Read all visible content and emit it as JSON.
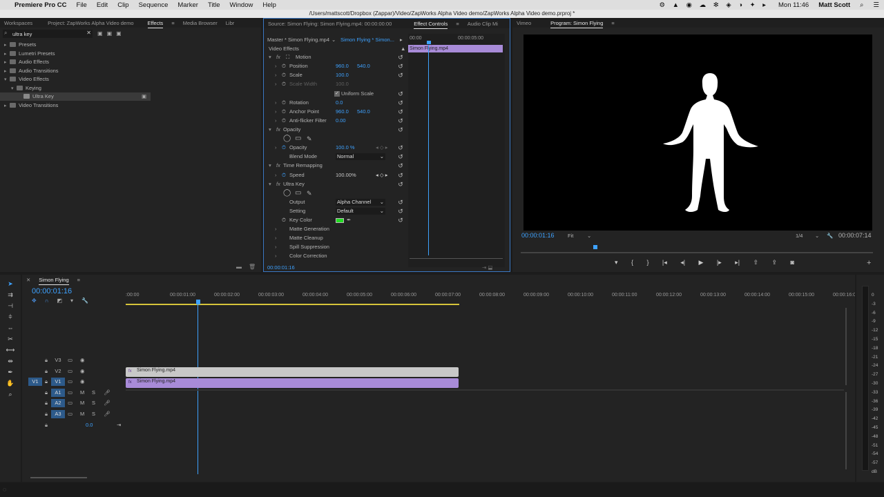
{
  "menubar": {
    "apple": "",
    "app": "Premiere Pro CC",
    "items": [
      "File",
      "Edit",
      "Clip",
      "Sequence",
      "Marker",
      "Title",
      "Window",
      "Help"
    ],
    "clock": "Mon 11:46",
    "user": "Matt Scott"
  },
  "titlebar": {
    "path": "/Users/mattscott/Dropbox (Zappar)/Video/ZapWorks Alpha Video demo/ZapWorks Alpha Video demo.prproj *"
  },
  "project_panel": {
    "tabs": [
      "Workspaces",
      "Project: ZapWorks Alpha Video demo",
      "Effects",
      "Media Browser",
      "Libr"
    ],
    "search_value": "ultra key",
    "tree": [
      {
        "label": "Presets",
        "depth": 0
      },
      {
        "label": "Lumetri Presets",
        "depth": 0
      },
      {
        "label": "Audio Effects",
        "depth": 0
      },
      {
        "label": "Audio Transitions",
        "depth": 0
      },
      {
        "label": "Video Effects",
        "depth": 0,
        "open": true
      },
      {
        "label": "Keying",
        "depth": 1,
        "open": true
      },
      {
        "label": "Ultra Key",
        "depth": 2,
        "selected": true
      },
      {
        "label": "Video Transitions",
        "depth": 0
      }
    ]
  },
  "effect_controls": {
    "tabs": [
      "Source: Simon Flying: Simon Flying.mp4: 00:00:00:00",
      "Effect Controls",
      "Audio Clip Mi"
    ],
    "master": "Master * Simon Flying.mp4",
    "seq": "Simon Flying * Simon...",
    "ruler": [
      "00:00",
      "00:00:05:00"
    ],
    "clip_label": "Simon Flying.mp4",
    "section": "Video Effects",
    "rows": [
      {
        "label": "Motion",
        "type": "fx"
      },
      {
        "label": "Position",
        "v1": "960.0",
        "v2": "540.0"
      },
      {
        "label": "Scale",
        "v1": "100.0"
      },
      {
        "label": "Scale Width",
        "v1": "100.0",
        "dim": true
      },
      {
        "label": "Uniform Scale",
        "type": "check"
      },
      {
        "label": "Rotation",
        "v1": "0.0"
      },
      {
        "label": "Anchor Point",
        "v1": "960.0",
        "v2": "540.0"
      },
      {
        "label": "Anti-flicker Filter",
        "v1": "0.00"
      },
      {
        "label": "Opacity",
        "type": "fx"
      },
      {
        "label": "",
        "type": "masks"
      },
      {
        "label": "Opacity",
        "v1": "100.0 %"
      },
      {
        "label": "Blend Mode",
        "dropdown": "Normal"
      },
      {
        "label": "Time Remapping",
        "type": "fx"
      },
      {
        "label": "Speed",
        "v1": "100.00%"
      },
      {
        "label": "Ultra Key",
        "type": "fx"
      },
      {
        "label": "",
        "type": "masks"
      },
      {
        "label": "Output",
        "dropdown": "Alpha Channel"
      },
      {
        "label": "Setting",
        "dropdown": "Default"
      },
      {
        "label": "Key Color",
        "type": "color"
      },
      {
        "label": "Matte Generation",
        "type": "group"
      },
      {
        "label": "Matte Cleanup",
        "type": "group"
      },
      {
        "label": "Spill Suppression",
        "type": "group"
      },
      {
        "label": "Color Correction",
        "type": "group"
      }
    ],
    "timecode": "00:00:01:16",
    "key_color": "#22dd22"
  },
  "program_monitor": {
    "tabs": [
      "Vimeo",
      "Program: Simon Flying"
    ],
    "timecode": "00:00:01:16",
    "fit": "Fit",
    "quality": "1/4",
    "duration": "00:00:07:14"
  },
  "timeline": {
    "tab": "Simon Flying",
    "timecode": "00:00:01:16",
    "ruler": [
      ":00:00",
      "00:00:01:00",
      "00:00:02:00",
      "00:00:03:00",
      "00:00:04:00",
      "00:00:05:00",
      "00:00:06:00",
      "00:00:07:00",
      "00:00:08:00",
      "00:00:09:00",
      "00:00:10:00",
      "00:00:11:00",
      "00:00:12:00",
      "00:00:13:00",
      "00:00:14:00",
      "00:00:15:00",
      "00:00:16:0"
    ],
    "tracks_video": [
      "V3",
      "V2",
      "V1"
    ],
    "tracks_audio": [
      "A1",
      "A2",
      "A3"
    ],
    "source_v": "V1",
    "master_vol": "0.0",
    "clip_v2": "Simon Flying.mp4",
    "clip_v1": "Simon Flying.mp4",
    "meter_labels": [
      "0",
      "-3",
      "-6",
      "-9",
      "-12",
      "-15",
      "-18",
      "-21",
      "-24",
      "-27",
      "-30",
      "-33",
      "-36",
      "-39",
      "-42",
      "-45",
      "-48",
      "-51",
      "-54",
      "-57",
      "dB"
    ]
  }
}
